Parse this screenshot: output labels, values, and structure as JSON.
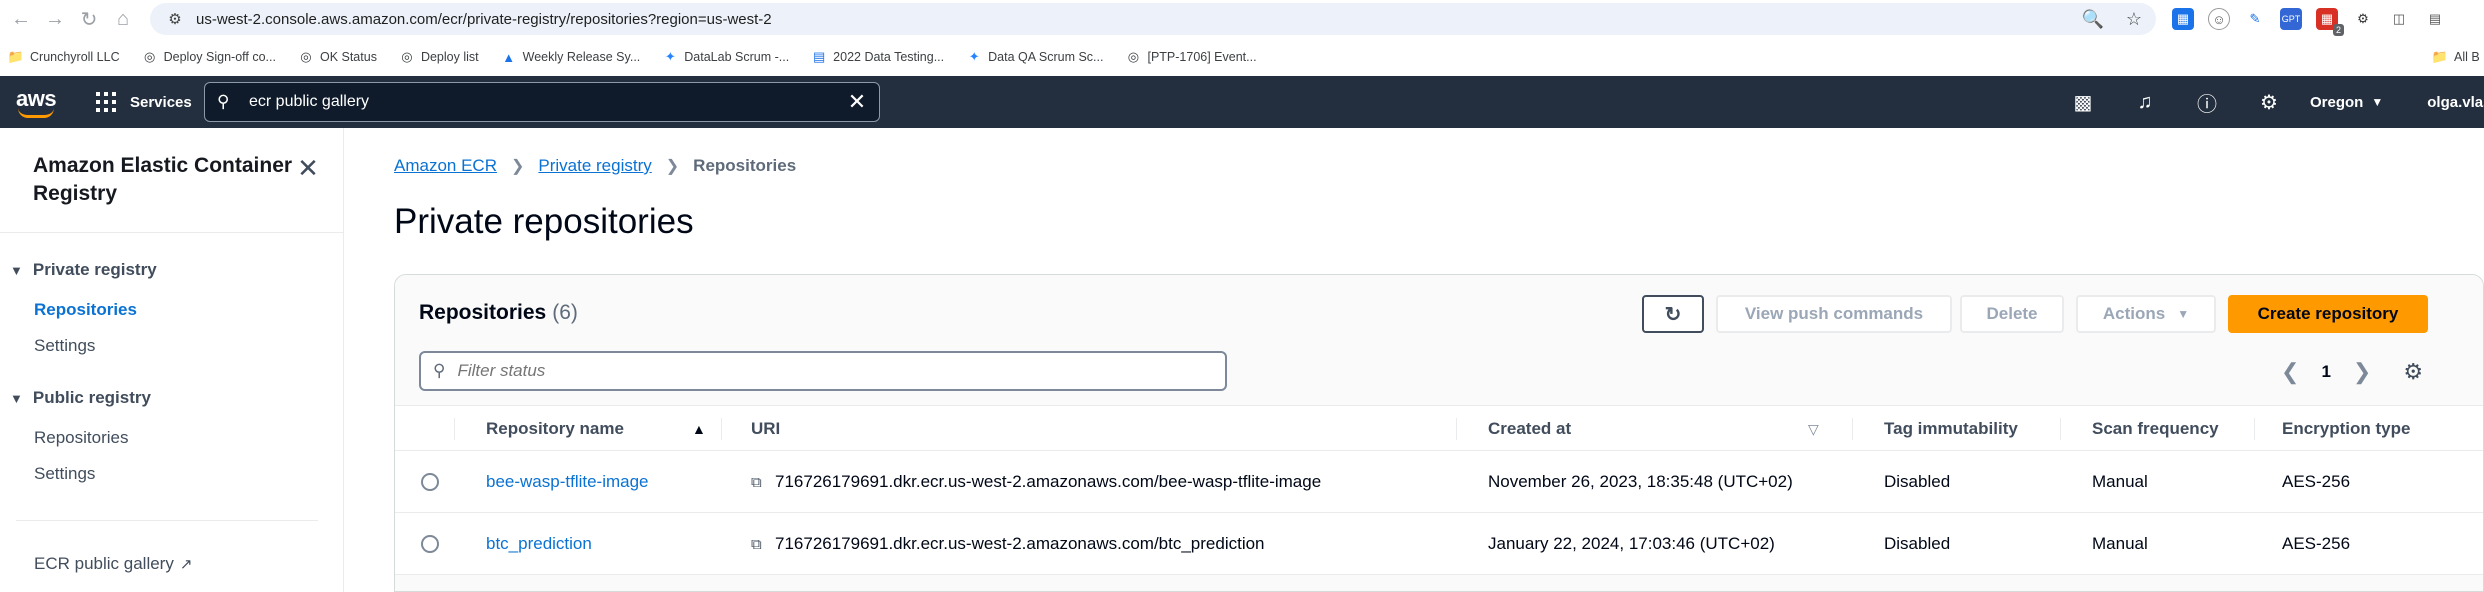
{
  "browser": {
    "url": "us-west-2.console.aws.amazon.com/ecr/private-registry/repositories?region=us-west-2",
    "ext_badge": "2",
    "bookmarks": [
      {
        "label": "Crunchyroll LLC",
        "icon": "folder-icon"
      },
      {
        "label": "Deploy Sign-off co...",
        "icon": "globe-icon"
      },
      {
        "label": "OK Status",
        "icon": "globe-icon"
      },
      {
        "label": "Deploy list",
        "icon": "globe-icon"
      },
      {
        "label": "Weekly Release Sy...",
        "icon": "triangle-icon"
      },
      {
        "label": "DataLab Scrum -...",
        "icon": "jira-icon"
      },
      {
        "label": "2022 Data Testing...",
        "icon": "doc-icon"
      },
      {
        "label": "Data QA Scrum Sc...",
        "icon": "jira-icon"
      },
      {
        "label": "[PTP-1706] Event...",
        "icon": "globe-icon"
      }
    ],
    "all_bookmarks": "All B"
  },
  "aws_header": {
    "logo": "aws",
    "services_label": "Services",
    "search_value": "ecr public gallery",
    "region": "Oregon",
    "user": "olga.vlase"
  },
  "sidenav": {
    "title": "Amazon Elastic Container Registry",
    "private_registry": "Private registry",
    "private_repositories": "Repositories",
    "private_settings": "Settings",
    "public_registry": "Public registry",
    "public_repositories": "Repositories",
    "public_settings": "Settings",
    "ecr_public_gallery": "ECR public gallery"
  },
  "main": {
    "breadcrumb": {
      "root": "Amazon ECR",
      "middle": "Private registry",
      "current": "Repositories"
    },
    "title": "Private repositories",
    "repos_heading": "Repositories",
    "repos_count": "(6)",
    "buttons": {
      "view_push": "View push commands",
      "delete": "Delete",
      "actions": "Actions",
      "create": "Create repository"
    },
    "filter_placeholder": "Filter status",
    "page": "1",
    "columns": {
      "name": "Repository name",
      "uri": "URI",
      "created": "Created at",
      "tag_immutability": "Tag immutability",
      "scan_frequency": "Scan frequency",
      "encryption": "Encryption type"
    },
    "rows": [
      {
        "name": "bee-wasp-tflite-image",
        "uri": "716726179691.dkr.ecr.us-west-2.amazonaws.com/bee-wasp-tflite-image",
        "created": "November 26, 2023, 18:35:48 (UTC+02)",
        "tag_immutability": "Disabled",
        "scan_frequency": "Manual",
        "encryption": "AES-256"
      },
      {
        "name": "btc_prediction",
        "uri": "716726179691.dkr.ecr.us-west-2.amazonaws.com/btc_prediction",
        "created": "January 22, 2024, 17:03:46 (UTC+02)",
        "tag_immutability": "Disabled",
        "scan_frequency": "Manual",
        "encryption": "AES-256"
      }
    ]
  },
  "colors": {
    "aws_header_bg": "#232f3e",
    "link_blue": "#0972d3",
    "primary_orange": "#ff9900"
  }
}
